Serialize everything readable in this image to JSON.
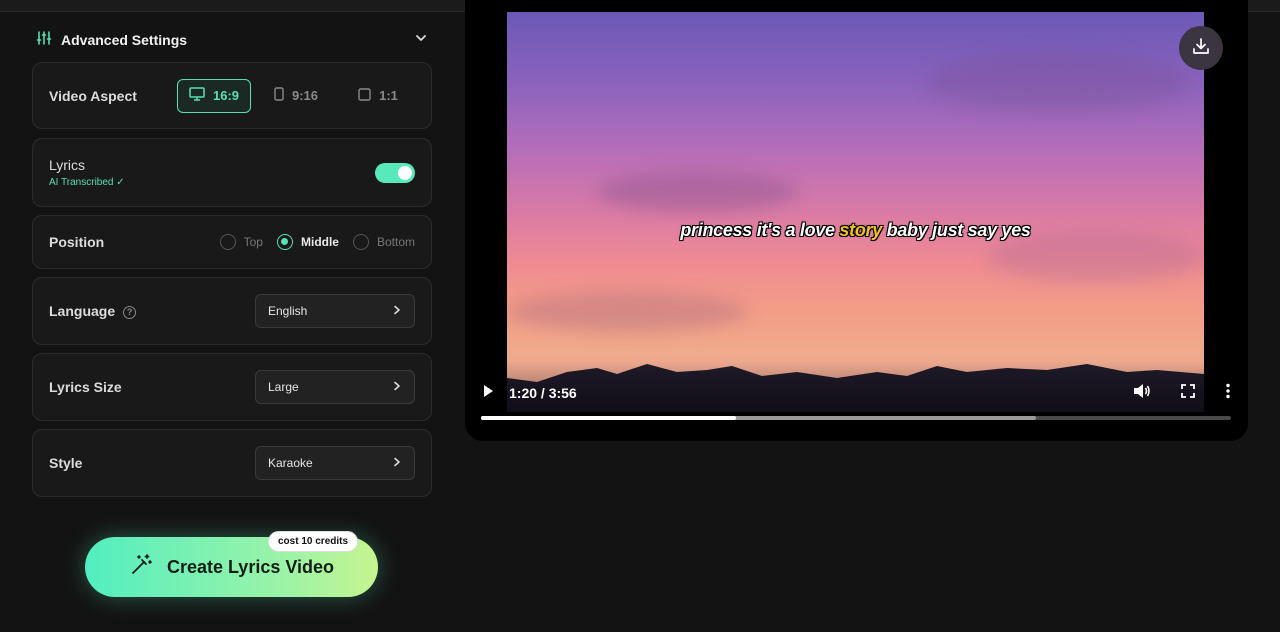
{
  "advanced": {
    "title": "Advanced Settings"
  },
  "video_aspect": {
    "label": "Video Aspect",
    "options": [
      "16:9",
      "9:16",
      "1:1"
    ],
    "selected": "16:9"
  },
  "lyrics": {
    "label": "Lyrics",
    "status": "AI Transcribed ✓",
    "enabled": true
  },
  "position": {
    "label": "Position",
    "options": [
      "Top",
      "Middle",
      "Bottom"
    ],
    "selected": "Middle"
  },
  "language": {
    "label": "Language",
    "value": "English"
  },
  "lyrics_size": {
    "label": "Lyrics Size",
    "value": "Large"
  },
  "style": {
    "label": "Style",
    "value": "Karaoke"
  },
  "cta": {
    "label": "Create Lyrics Video",
    "badge": "cost 10 credits"
  },
  "video": {
    "lyric_before": "princess it's a love ",
    "lyric_highlight": "story",
    "lyric_after": " baby just say yes",
    "time": "1:20 / 3:56",
    "played_fraction": 0.34,
    "buffered_fraction": 0.74
  },
  "colors": {
    "accent": "#57e0b2",
    "highlight": "#f2c124"
  },
  "icons": [
    "sliders-icon",
    "chevron-down-icon",
    "monitor-icon",
    "phone-icon",
    "square-icon",
    "help-icon",
    "chevron-right-icon",
    "magic-wand-icon",
    "download-icon",
    "play-icon",
    "volume-icon",
    "fullscreen-icon",
    "more-vertical-icon"
  ]
}
